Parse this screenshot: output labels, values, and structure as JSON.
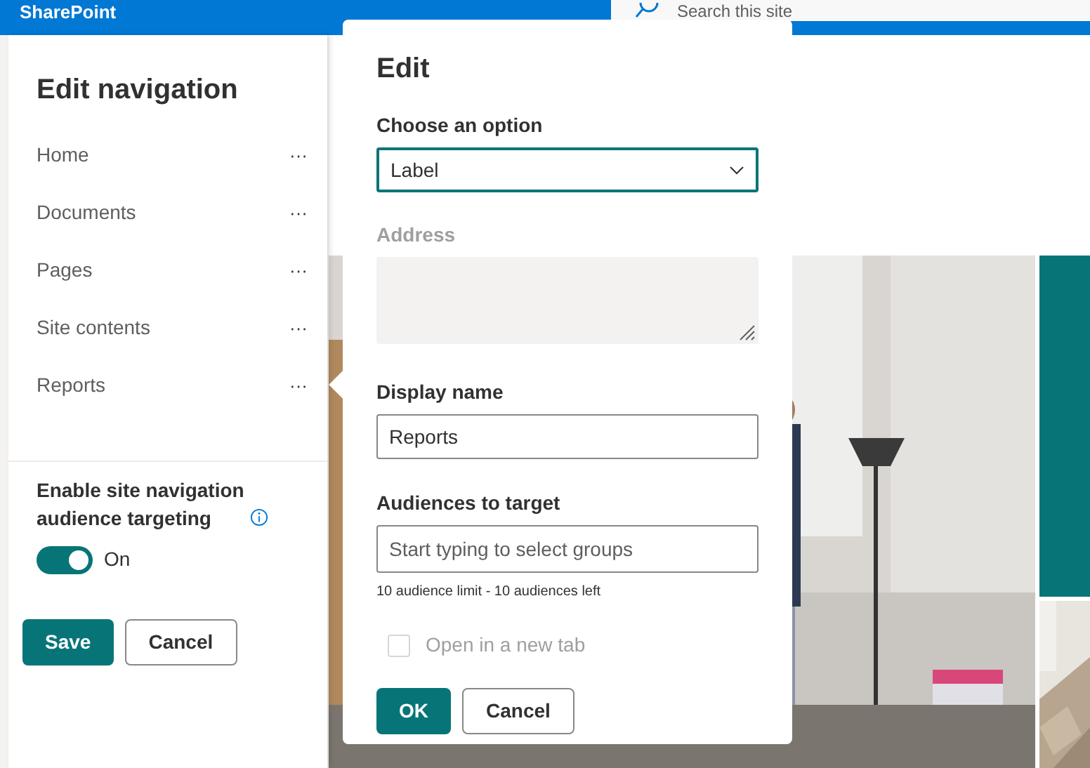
{
  "header": {
    "brand": "SharePoint",
    "search_placeholder": "Search this site"
  },
  "nav_panel": {
    "title": "Edit navigation",
    "items": [
      {
        "label": "Home",
        "more": "···"
      },
      {
        "label": "Documents",
        "more": "···"
      },
      {
        "label": "Pages",
        "more": "···"
      },
      {
        "label": "Site contents",
        "more": "···"
      },
      {
        "label": "Reports",
        "more": "···"
      }
    ],
    "targeting_label": "Enable site navigation audience targeting",
    "targeting_on": true,
    "targeting_state": "On",
    "buttons": [
      "Save",
      "Cancel"
    ]
  },
  "dialog": {
    "title": "Edit",
    "option_label": "Choose an option",
    "option_value": "Label",
    "address_label": "Address",
    "address_disabled": true,
    "display_name_label": "Display name",
    "display_name_value": "Reports",
    "audiences_label": "Audiences to target",
    "audiences_placeholder": "Start typing to select groups",
    "audience_hint": "10 audience limit - 10 audiences left",
    "new_tab_label": "Open in a new tab",
    "new_tab_checked": false,
    "new_tab_disabled": true,
    "buttons": [
      "OK",
      "Cancel"
    ]
  }
}
